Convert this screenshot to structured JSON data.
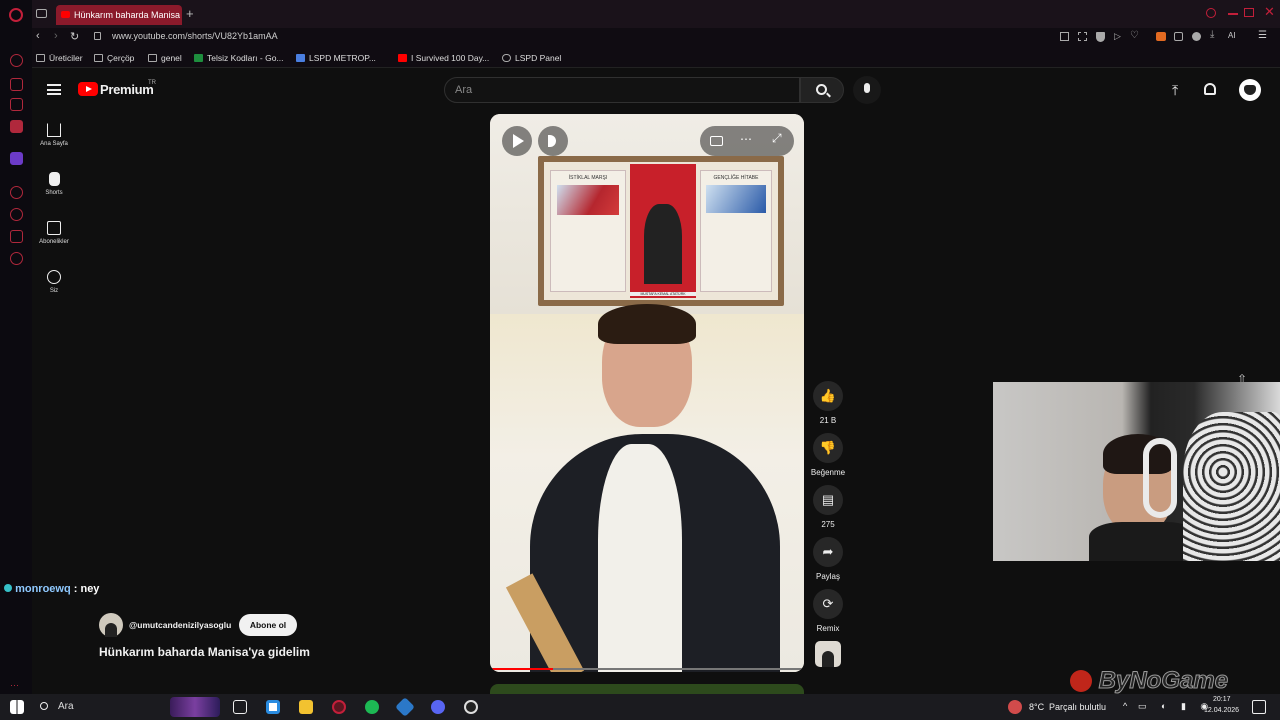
{
  "browser": {
    "tab_title": "Hünkarım baharda Manisa",
    "url": "www.youtube.com/shorts/VU82Yb1amAA",
    "ai_label": "AI",
    "bookmarks": [
      "Üreticiler",
      "Çerçöp",
      "genel",
      "Telsiz Kodları - Go...",
      "LSPD METROP...",
      "I Survived 100 Day...",
      "LSPD Panel"
    ]
  },
  "youtube": {
    "logo_text": "Premium",
    "logo_sup": "TR",
    "search_placeholder": "Ara",
    "nav": [
      "Ana Sayfa",
      "Shorts",
      "Abonelikler",
      "Siz"
    ]
  },
  "short": {
    "channel": "@umutcandenizilyasoglu",
    "subscribe_label": "Abone ol",
    "title": "Hünkarım baharda Manisa'ya gidelim",
    "likes": "21 B",
    "dislike_label": "Beğenme",
    "comments": "275",
    "share_label": "Paylaş",
    "remix_label": "Remix",
    "frame_poster_left": "İSTİKLAL MARŞI",
    "frame_poster_right": "GENÇLİĞE HİTABE",
    "frame_caption": "MUSTAFA KEMAL ATATÜRK"
  },
  "chat": {
    "user": "monroewq",
    "message": ": ney"
  },
  "overlay": {
    "watermark": "ByNoGame"
  },
  "taskbar": {
    "search_label": "Ara",
    "weather": "8°C",
    "weather_text": "Parçalı bulutlu",
    "time": "20:17",
    "date": "12.04.2026"
  },
  "colors": {
    "accent": "#ff0000",
    "opera_red": "#b0283c",
    "bg": "#0f0f0f"
  }
}
